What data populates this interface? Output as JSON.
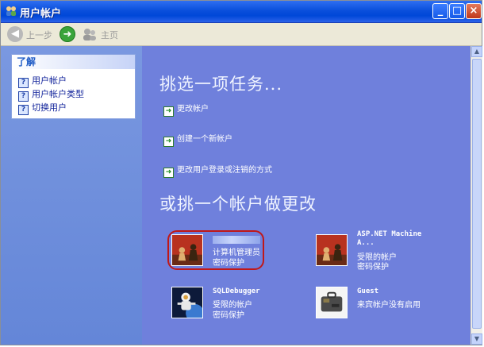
{
  "window": {
    "title": "用户帐户"
  },
  "toolbar": {
    "back_label": "上一步",
    "home_label": "主页"
  },
  "learn": {
    "heading": "了解",
    "items": [
      "用户帐户",
      "用户帐户类型",
      "切换用户"
    ]
  },
  "main": {
    "task_heading": "挑选一项任务...",
    "tasks": [
      "更改帐户",
      "创建一个新帐户",
      "更改用户登录或注销的方式"
    ],
    "account_heading": "或挑一个帐户做更改",
    "accounts": [
      {
        "name": "",
        "line2": "计算机管理员",
        "line3": "密码保护",
        "picture": "chess-icon"
      },
      {
        "name": "ASP.NET Machine A...",
        "line2": "受限的帐户",
        "line3": "密码保护",
        "picture": "chess-icon"
      },
      {
        "name": "SQLDebugger",
        "line2": "受限的帐户",
        "line3": "密码保护",
        "picture": "astronaut-icon"
      },
      {
        "name": "Guest",
        "line2": "来宾帐户没有启用",
        "line3": "",
        "picture": "suitcase-icon"
      }
    ]
  },
  "colors": {
    "main_bg": "#6f80dc",
    "left_bg": "#6486d8",
    "highlight": "#c01818"
  }
}
